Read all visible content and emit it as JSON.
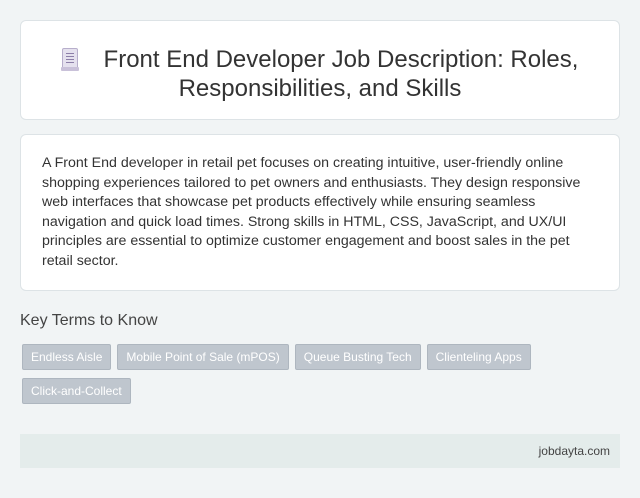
{
  "header": {
    "icon": "document-icon",
    "title": "Front End Developer Job Description: Roles, Responsibilities, and Skills"
  },
  "description": "A Front End developer in retail pet focuses on creating intuitive, user-friendly online shopping experiences tailored to pet owners and enthusiasts. They design responsive web interfaces that showcase pet products effectively while ensuring seamless navigation and quick load times. Strong skills in HTML, CSS, JavaScript, and UX/UI principles are essential to optimize customer engagement and boost sales in the pet retail sector.",
  "key_terms": {
    "heading": "Key Terms to Know",
    "tags": [
      "Endless Aisle",
      "Mobile Point of Sale (mPOS)",
      "Queue Busting Tech",
      "Clienteling Apps",
      "Click-and-Collect"
    ]
  },
  "footer": {
    "site": "jobdayta.com"
  },
  "colors": {
    "background": "#f1f4f5",
    "tag": "#bfc6ce",
    "footer": "#e4eceb"
  }
}
